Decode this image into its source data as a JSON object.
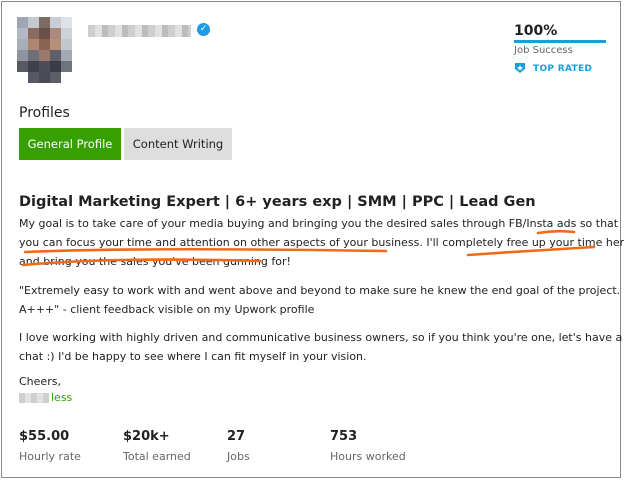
{
  "header": {
    "job_success": {
      "value": "100%",
      "label": "Job Success",
      "percent": 100
    },
    "badge": {
      "label": "TOP RATED",
      "icon": "top-rated-shield-icon"
    },
    "verified_icon": "verified-check-icon"
  },
  "profiles": {
    "title": "Profiles",
    "tabs": [
      {
        "label": "General Profile",
        "active": true
      },
      {
        "label": "Content Writing",
        "active": false
      }
    ]
  },
  "overview": {
    "title": "Digital Marketing Expert | 6+ years exp | SMM | PPC | Lead Gen",
    "p1_lines": [
      "My goal is to take care of your media buying and bringing you the desired sales through FB/Insta ads so that",
      "you can focus your time and attention on other aspects of your business. I'll completely free up your time here,",
      "and bring you the sales you've been gunning for!"
    ],
    "p2_lines": [
      "\"Extremely easy to work with and went above and beyond to make sure he knew the end goal of the project.",
      "A+++\" - client feedback visible on my Upwork profile"
    ],
    "p3_lines": [
      "I love working with highly driven and communicative business owners, so if you think you're one, let's have a",
      "chat :) I'd be happy to see where I can fit myself in your vision."
    ],
    "closing": "Cheers,",
    "signature_suffix": "less"
  },
  "stats": [
    {
      "value": "$55.00",
      "label": "Hourly rate"
    },
    {
      "value": "$20k+",
      "label": "Total earned"
    },
    {
      "value": "27",
      "label": "Jobs"
    },
    {
      "value": "753",
      "label": "Hours worked"
    }
  ],
  "colors": {
    "accent_green": "#37a000",
    "accent_blue": "#14a0de",
    "annotation": "#f06a1b"
  }
}
